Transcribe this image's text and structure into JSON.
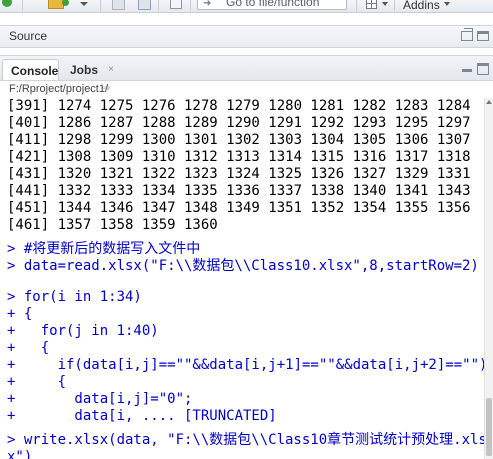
{
  "toolbar": {
    "goto_placeholder": "Go to file/function",
    "addins_label": "Addins"
  },
  "source_pane": {
    "title": "Source"
  },
  "console_pane": {
    "tabs": [
      {
        "label": "Console"
      },
      {
        "label": "Jobs",
        "close": "×"
      }
    ],
    "working_dir": "F:/Rproject/project1/",
    "output_lines": [
      "[391] 1274 1275 1276 1278 1279 1280 1281 1282 1283 1284",
      "[401] 1286 1287 1288 1289 1290 1291 1292 1293 1295 1297",
      "[411] 1298 1299 1300 1301 1302 1303 1304 1305 1306 1307",
      "[421] 1308 1309 1310 1312 1313 1314 1315 1316 1317 1318",
      "[431] 1320 1321 1322 1323 1324 1325 1326 1327 1329 1331",
      "[441] 1332 1333 1334 1335 1336 1337 1338 1340 1341 1343",
      "[451] 1344 1346 1347 1348 1349 1351 1352 1354 1355 1356",
      "[461] 1357 1358 1359 1360"
    ],
    "commands": [
      "> #将更新后的数据写入文件中",
      "> data=read.xlsx(\"F:\\\\数据包\\\\Class10.xlsx\",8,startRow=2)",
      "> for(i in 1:34)",
      "+ {",
      "+   for(j in 1:40)",
      "+   {",
      "+     if(data[i,j]==\"\"&&data[i,j+1]==\"\"&&data[i,j+2]==\"\")",
      "+     {",
      "+       data[i,j]=\"0\";",
      "+       data[i, .... [TRUNCATED]",
      "> write.xlsx(data, \"F:\\\\数据包\\\\Class10章节测试统计预处理.xls",
      "x\")"
    ]
  }
}
